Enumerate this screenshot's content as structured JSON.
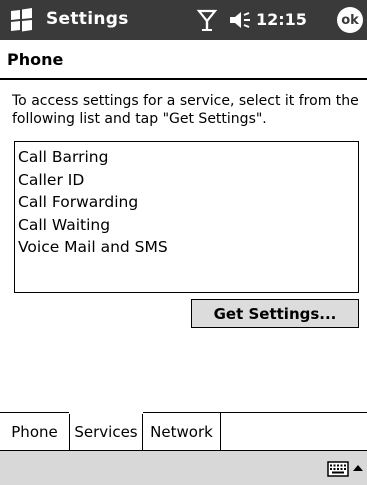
{
  "titlebar": {
    "title": "Settings",
    "time": "12:15",
    "ok_label": "ok"
  },
  "page": {
    "title": "Phone",
    "instructions": "To access settings for a service, select it from the following list and tap \"Get Settings\"."
  },
  "services": {
    "items": [
      {
        "label": "Call Barring"
      },
      {
        "label": "Caller ID"
      },
      {
        "label": "Call Forwarding"
      },
      {
        "label": "Call Waiting"
      },
      {
        "label": "Voice Mail and SMS"
      }
    ]
  },
  "button": {
    "get_settings": "Get Settings..."
  },
  "tabs": [
    {
      "label": "Phone",
      "active": false
    },
    {
      "label": "Services",
      "active": true
    },
    {
      "label": "Network",
      "active": false
    }
  ],
  "icons": {
    "start": "windows-flag-icon",
    "signal": "signal-antenna-icon",
    "volume": "speaker-icon",
    "keyboard": "keyboard-icon",
    "input_menu": "up-arrow-icon"
  }
}
